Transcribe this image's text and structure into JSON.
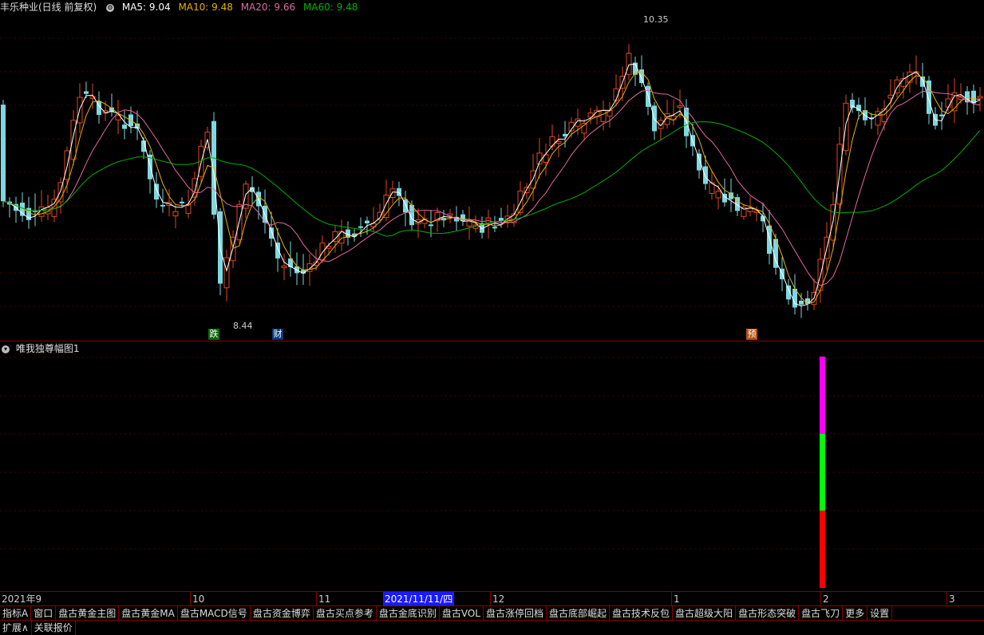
{
  "header": {
    "title": "丰乐种业(日线 前复权)",
    "ma5": "MA5: 9.04",
    "ma10": "MA10: 9.48",
    "ma20": "MA20: 9.66",
    "ma60": "MA60: 9.48",
    "ma5_color": "#ffffff",
    "ma10_color": "#e8b000",
    "ma20_color": "#e06aa0",
    "ma60_color": "#00b000"
  },
  "annotations": {
    "high_label": "10.35",
    "low_label": "8.44",
    "marker_die": "跌",
    "marker_cai": "财",
    "marker_yu": "预"
  },
  "sub_indicator": {
    "title": "唯我独尊幅图1",
    "bar_segments": [
      "#ff00ff",
      "#00ff00",
      "#ff0000"
    ]
  },
  "xaxis": {
    "labels": [
      "2021年9",
      "10",
      "11",
      "2021/11/11/四",
      "12",
      "1",
      "2",
      "3"
    ]
  },
  "tabs": [
    "指标A",
    "窗口",
    "盘古黄金主图",
    "盘古黄金MA",
    "盘古MACD信号",
    "盘古资金博弈",
    "盘古买点参考",
    "盘古金底识别",
    "盘古VOL",
    "盘古涨停回档",
    "盘古底部崛起",
    "盘古技术反包",
    "盘古超级大阳",
    "盘古形态突破",
    "盘古飞刀",
    "更多",
    "设置"
  ],
  "tabs2": [
    "扩展∧",
    "关联报价"
  ],
  "colors": {
    "up": "#e0481e",
    "down": "#7ed8e0",
    "grid": "#5a0000"
  }
}
